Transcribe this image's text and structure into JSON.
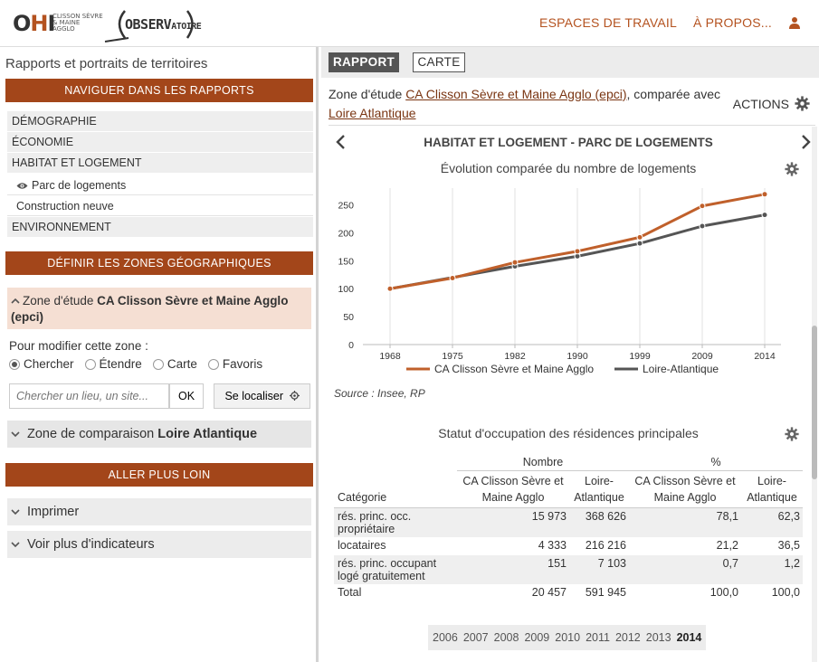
{
  "header": {
    "logo_ohi_big": "OHI",
    "logo_ohi_small": "CLISSON SÈVRE & MAINE AGGLO",
    "logo_obs": "OBSERV",
    "logo_obs_tail": "ATOIRE",
    "nav": [
      "ESPACES DE TRAVAIL",
      "À PROPOS..."
    ],
    "user_icon": "user-icon",
    "accent": "#b4521f"
  },
  "sidebar": {
    "title": "Rapports et portraits de territoires",
    "section_nav": "NAVIGUER DANS LES RAPPORTS",
    "menu": [
      {
        "label": "DÉMOGRAPHIE"
      },
      {
        "label": "ÉCONOMIE"
      },
      {
        "label": "HABITAT ET LOGEMENT"
      },
      {
        "label": "Parc de logements"
      },
      {
        "label": "Construction neuve"
      },
      {
        "label": "ENVIRONNEMENT"
      }
    ],
    "section_zones": "DÉFINIR LES ZONES GÉOGRAPHIQUES",
    "zone_etude_prefix": "Zone d'étude ",
    "zone_etude_name": "CA Clisson Sèvre et Maine Agglo (epci)",
    "modify_label": "Pour modifier cette zone :",
    "radios": [
      {
        "label": "Chercher",
        "checked": true
      },
      {
        "label": "Étendre",
        "checked": false
      },
      {
        "label": "Carte",
        "checked": false
      },
      {
        "label": "Favoris",
        "checked": false
      }
    ],
    "search_placeholder": "Chercher un lieu, un site...",
    "ok_label": "OK",
    "locate_label": "Se localiser",
    "zone_comp_prefix": "Zone de comparaison ",
    "zone_comp_name": "Loire Atlantique",
    "section_more": "ALLER PLUS LOIN",
    "print_label": "Imprimer",
    "more_indicators_label": "Voir plus d'indicateurs",
    "section_color": "#a3461a"
  },
  "main": {
    "tabs": [
      "RAPPORT",
      "CARTE"
    ],
    "zone_prefix": "Zone d'étude ",
    "zone_link": "CA Clisson Sèvre et Maine Agglo (epci)",
    "zone_middle": ", comparée avec",
    "zone_comp_link": "Loire Atlantique",
    "actions_label": "ACTIONS",
    "report_title": "HABITAT ET LOGEMENT - PARC DE LOGEMENTS",
    "chart_title": "Évolution comparée du nombre de logements",
    "source": "Source : Insee, RP",
    "table_title": "Statut d'occupation des résidences principales",
    "table": {
      "group_headers": [
        "Nombre",
        "%"
      ],
      "columns": [
        "Catégorie",
        "CA Clisson Sèvre et Maine Agglo",
        "Loire-Atlantique",
        "CA Clisson Sèvre et Maine Agglo",
        "Loire-Atlantique"
      ],
      "rows": [
        [
          "rés. princ. occ. propriétaire",
          "15 973",
          "368 626",
          "78,1",
          "62,3"
        ],
        [
          "locataires",
          "4 333",
          "216 216",
          "21,2",
          "36,5"
        ],
        [
          "rés. princ. occupant logé gratuitement",
          "151",
          "7 103",
          "0,7",
          "1,2"
        ],
        [
          "Total",
          "20 457",
          "591 945",
          "100,0",
          "100,0"
        ]
      ]
    },
    "years": [
      "2006",
      "2007",
      "2008",
      "2009",
      "2010",
      "2011",
      "2012",
      "2013",
      "2014"
    ],
    "selected_year": "2014"
  },
  "chart_data": {
    "type": "line",
    "title": "Évolution comparée du nombre de logements",
    "x": [
      "1968",
      "1975",
      "1982",
      "1990",
      "1999",
      "2009",
      "2014"
    ],
    "series": [
      {
        "name": "CA Clisson Sèvre et Maine Agglo",
        "color": "#c0602b",
        "values": [
          100,
          119,
          147,
          167,
          192,
          248,
          269
        ]
      },
      {
        "name": "Loire-Atlantique",
        "color": "#555555",
        "values": [
          100,
          120,
          140,
          158,
          181,
          212,
          232
        ]
      }
    ],
    "yticks": [
      0,
      50,
      100,
      150,
      200,
      250
    ],
    "ylim": [
      0,
      280
    ],
    "grid": "vertical",
    "legend": "bottom"
  }
}
